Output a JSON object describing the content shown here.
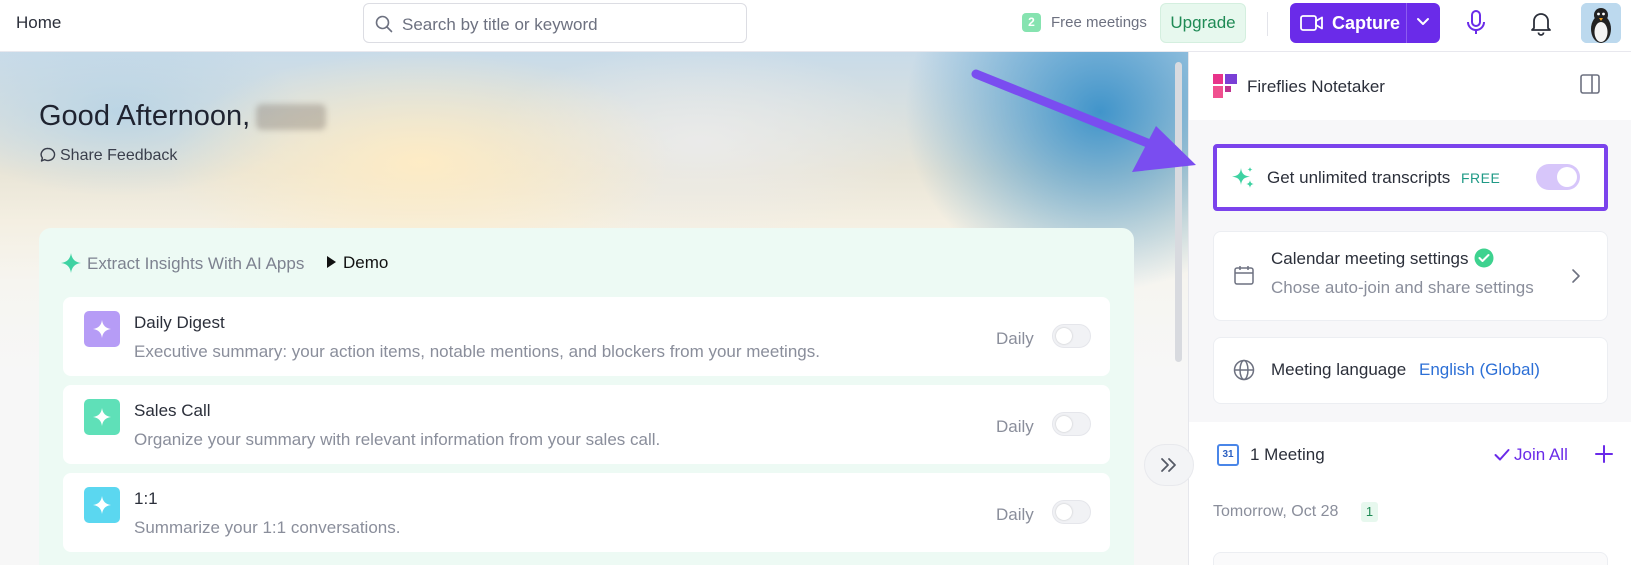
{
  "topbar": {
    "home_label": "Home",
    "search_placeholder": "Search by title or keyword",
    "free_meetings_count": "2",
    "free_meetings_label": "Free meetings",
    "upgrade_label": "Upgrade",
    "capture_label": "Capture"
  },
  "hero": {
    "greeting": "Good Afternoon,",
    "share_feedback": "Share Feedback"
  },
  "ai_apps": {
    "heading": "Extract Insights With AI Apps",
    "demo_label": "Demo",
    "items": [
      {
        "title": "Daily Digest",
        "description": "Executive summary: your action items, notable mentions, and blockers from your meetings.",
        "frequency": "Daily",
        "enabled": false,
        "color": "#b69cf6"
      },
      {
        "title": "Sales Call",
        "description": "Organize your summary with relevant information from your sales call.",
        "frequency": "Daily",
        "enabled": false,
        "color": "#5fe0b8"
      },
      {
        "title": "1:1",
        "description": "Summarize your 1:1 conversations.",
        "frequency": "Daily",
        "enabled": false,
        "color": "#5bd7f0"
      }
    ]
  },
  "right_panel": {
    "title": "Fireflies Notetaker",
    "unlimited": {
      "label": "Get unlimited transcripts",
      "badge": "FREE",
      "enabled": true
    },
    "calendar_settings": {
      "title": "Calendar meeting settings",
      "subtitle": "Chose auto-join and share settings"
    },
    "meeting_language": {
      "label": "Meeting language",
      "value": "English (Global)"
    },
    "meetings": {
      "count_label": "1 Meeting",
      "join_all": "Join All",
      "calendar_day": "31",
      "day_label": "Tomorrow, Oct 28",
      "day_count": "1"
    }
  },
  "colors": {
    "accent": "#6a2be9",
    "highlight_border": "#7b43ec",
    "arrow": "#7a4df0"
  }
}
